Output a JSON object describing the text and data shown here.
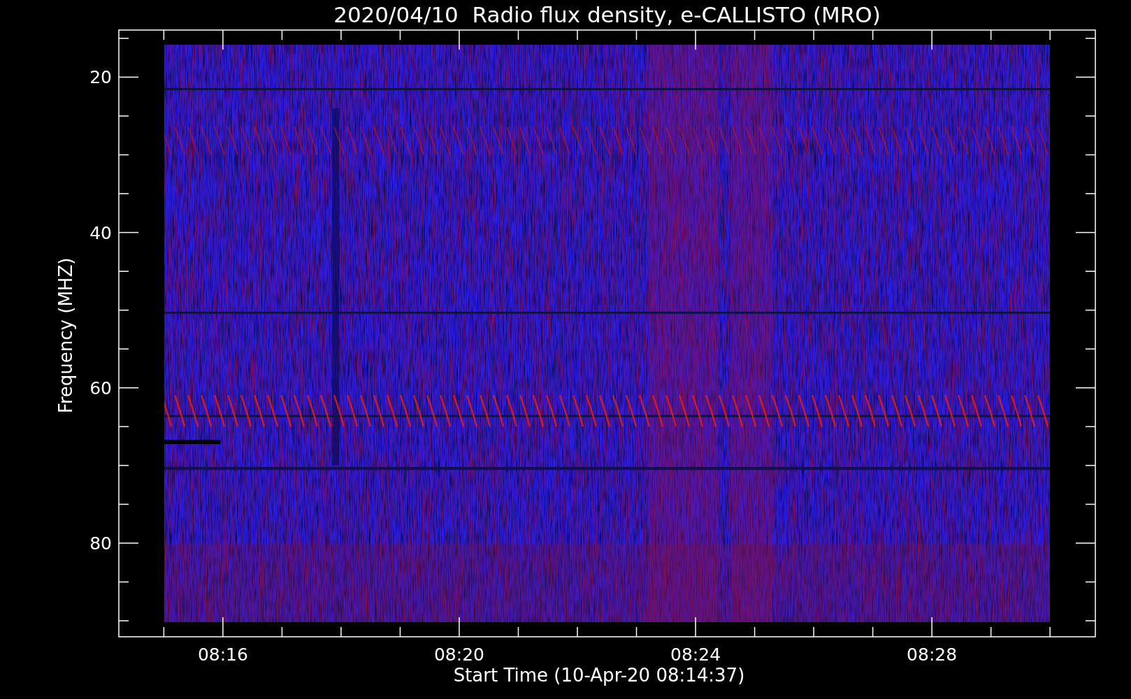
{
  "title": "2020/04/10  Radio flux density, e-CALLISTO (MRO)",
  "plot": {
    "xlabel": "Start Time (10-Apr-20 08:14:37)",
    "ylabel": "Frequency (MHZ)",
    "xticks": [
      "08:16",
      "08:20",
      "08:24",
      "08:28"
    ],
    "yticks": [
      "20",
      "40",
      "60",
      "80"
    ]
  }
}
